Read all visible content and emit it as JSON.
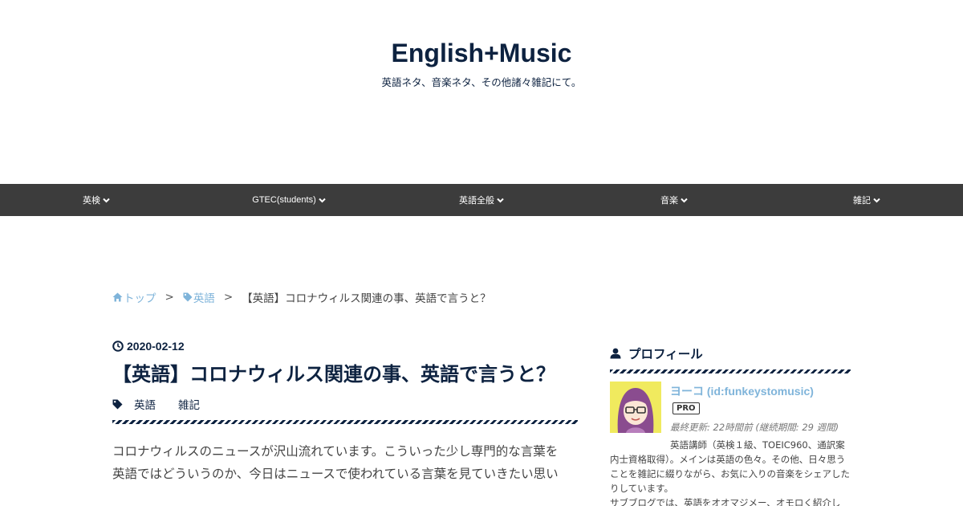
{
  "site": {
    "title": "English+Music",
    "description": "英語ネタ、音楽ネタ、その他諸々雑記にて。"
  },
  "nav": {
    "items": [
      {
        "label": "英検",
        "icon": "chevron-down-icon"
      },
      {
        "label": "GTEC(students)",
        "icon": "chevron-down-icon"
      },
      {
        "label": "英語全般",
        "icon": "chevron-down-icon"
      },
      {
        "label": "音楽",
        "icon": "chevron-down-icon"
      },
      {
        "label": "雑記",
        "icon": "chevron-down-icon"
      }
    ]
  },
  "breadcrumb": {
    "home": "トップ",
    "category": "英語",
    "separator": ">",
    "current": "【英語】コロナウィルス関連の事、英語で言うと？"
  },
  "entry": {
    "date": "2020-02-12",
    "title": "【英語】コロナウィルス関連の事、英語で言うと？",
    "categories": [
      "英語",
      "雑記"
    ],
    "body_lines": [
      "コロナウィルスのニュースが沢山流れています。こういった少し専門的な言葉を",
      "英語ではどういうのか、今日はニュースで使われている言葉を見ていきたい思い"
    ]
  },
  "sidebar": {
    "profile": {
      "heading": "プロフィール",
      "name": "ヨーコ (id:funkeystomusic)",
      "badge": "PRO",
      "last_update": "最終更新: 22時間前 (継続期間: 29 週間)",
      "description_lines": [
        "英語講師（英検１級、TOEIC960、通訳案内士資格取得）。メインは英語の色々。その他、日々思うことを雑記に綴りながら、お気に入りの音楽をシェアしたりしています。",
        "サブブログでは、英語をオオマジメー、オモロく紹介し"
      ]
    }
  },
  "colors": {
    "primary": "#0d2240",
    "nav_background": "#3c3c3c",
    "link": "#7fb4da",
    "avatar_background": "#f0ea5e"
  }
}
